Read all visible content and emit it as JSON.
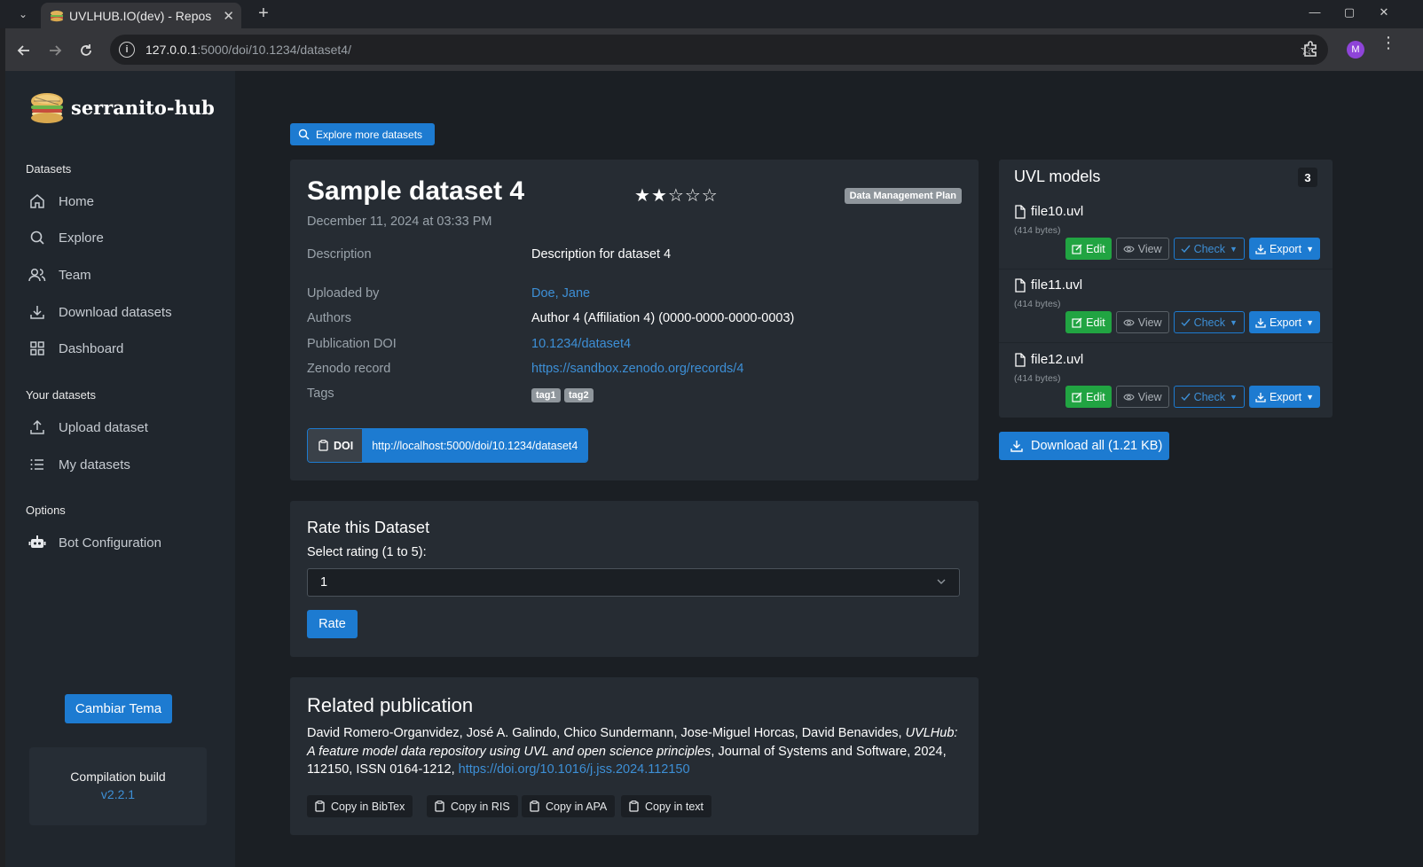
{
  "browser": {
    "tab_title": "UVLHUB.IO(dev) - Repos",
    "url_host": "127.0.0.1",
    "url_path": ":5000/doi/10.1234/dataset4/",
    "profile_initial": "M"
  },
  "sidebar": {
    "brand": "serranito-hub",
    "section_datasets": "Datasets",
    "section_your_datasets": "Your datasets",
    "section_options": "Options",
    "items": [
      {
        "label": "Home",
        "icon": "home-icon"
      },
      {
        "label": "Explore",
        "icon": "search-icon"
      },
      {
        "label": "Team",
        "icon": "users-icon"
      },
      {
        "label": "Download datasets",
        "icon": "download-icon"
      },
      {
        "label": "Dashboard",
        "icon": "grid-icon"
      },
      {
        "label": "Upload dataset",
        "icon": "upload-icon"
      },
      {
        "label": "My datasets",
        "icon": "list-icon"
      },
      {
        "label": "Bot Configuration",
        "icon": "robot-icon"
      }
    ],
    "theme_button": "Cambiar Tema",
    "build_label": "Compilation build",
    "build_version": "v2.2.1"
  },
  "main": {
    "explore_button": "Explore more datasets",
    "dataset": {
      "title": "Sample dataset 4",
      "rating_filled": 2,
      "rating_total": 5,
      "badge": "Data Management Plan",
      "date": "December 11, 2024 at 03:33 PM",
      "description_label": "Description",
      "description": "Description for dataset 4",
      "uploaded_by_label": "Uploaded by",
      "uploaded_by": "Doe, Jane",
      "authors_label": "Authors",
      "authors": "Author 4 (Affiliation 4) (0000-0000-0000-0003)",
      "doi_label": "Publication DOI",
      "doi": "10.1234/dataset4",
      "zenodo_label": "Zenodo record",
      "zenodo": "https://sandbox.zenodo.org/records/4",
      "tags_label": "Tags",
      "tags": [
        "tag1",
        "tag2"
      ],
      "doi_button_label": "DOI",
      "doi_button_url": "http://localhost:5000/doi/10.1234/dataset4"
    },
    "rate": {
      "title": "Rate this Dataset",
      "label": "Select rating (1 to 5):",
      "selected": "1",
      "button": "Rate"
    },
    "publication": {
      "title": "Related publication",
      "authors": "David Romero-Organvidez, José A. Galindo, Chico Sundermann, Jose-Miguel Horcas, David Benavides,",
      "paper_title": "UVLHub: A feature model data repository using UVL and open science principles",
      "journal": ", Journal of Systems and Software, 2024, 112150, ISSN 0164-1212,",
      "link": "https://doi.org/10.1016/j.jss.2024.112150",
      "copy_buttons": [
        "Copy in BibTex",
        "Copy in RIS",
        "Copy in APA",
        "Copy in text"
      ]
    },
    "uvl": {
      "title": "UVL models",
      "count": "3",
      "files": [
        {
          "name": "file10.uvl",
          "size": "(414 bytes)"
        },
        {
          "name": "file11.uvl",
          "size": "(414 bytes)"
        },
        {
          "name": "file12.uvl",
          "size": "(414 bytes)"
        }
      ],
      "edit": "Edit",
      "view": "View",
      "check": "Check",
      "export": "Export"
    },
    "download_all": "Download all (1.21 KB)"
  },
  "colors": {
    "primary": "#1d7bd1",
    "success": "#21a442",
    "card_bg": "#262c33",
    "page_bg": "#1b1f24",
    "sidebar_bg": "#20262d"
  }
}
